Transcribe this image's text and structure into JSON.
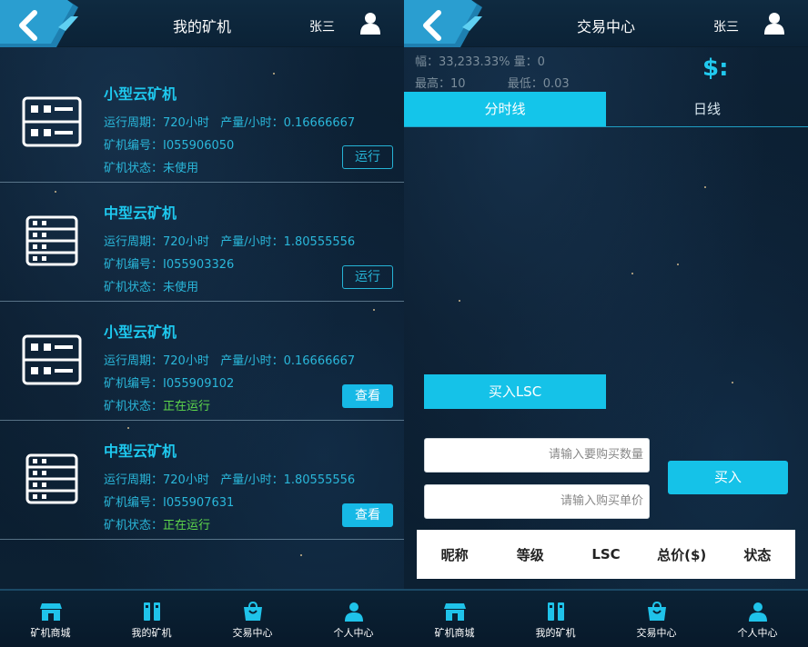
{
  "left_screen": {
    "header": {
      "title": "我的矿机",
      "user_name": "张三"
    },
    "machines": [
      {
        "name": "小型云矿机",
        "cycle": "运行周期：720小时",
        "output": "产量/小时：0.16666667",
        "id_label": "矿机编号：",
        "id": "I055906050",
        "status_label": "矿机状态：",
        "status": "未使用",
        "action": "运行"
      },
      {
        "name": "中型云矿机",
        "cycle": "运行周期：720小时",
        "output": "产量/小时：1.80555556",
        "id_label": "矿机编号：",
        "id": "I055903326",
        "status_label": "矿机状态：",
        "status": "未使用",
        "action": "运行"
      },
      {
        "name": "小型云矿机",
        "cycle": "运行周期：720小时",
        "output": "产量/小时：0.16666667",
        "id_label": "矿机编号：",
        "id": "I055909102",
        "status_label": "矿机状态：",
        "status": "正在运行",
        "action": "查看"
      },
      {
        "name": "中型云矿机",
        "cycle": "运行周期：720小时",
        "output": "产量/小时：1.80555556",
        "id_label": "矿机编号：",
        "id": "I055907631",
        "status_label": "矿机状态：",
        "status": "正在运行",
        "action": "查看"
      }
    ]
  },
  "right_screen": {
    "header": {
      "title": "交易中心",
      "user_name": "张三"
    },
    "ticker": {
      "change": "幅：33,233.33%",
      "volume": "量：0",
      "high": "最高：10",
      "low": "最低：0.03"
    },
    "dollar_symbol": "$:",
    "tabs": [
      {
        "label": "分时线",
        "active": true
      },
      {
        "label": "日线",
        "active": false
      }
    ],
    "buy_tab_label": "买入LSC",
    "quantity_placeholder": "请输入要购买数量",
    "price_placeholder": "请输入购买单价",
    "buy_button_label": "买入",
    "table_headers": [
      "昵称",
      "等级",
      "LSC",
      "总价($)",
      "状态"
    ]
  },
  "bottom_nav": [
    {
      "label": "矿机商城",
      "icon": "shop-icon"
    },
    {
      "label": "我的矿机",
      "icon": "machine-icon"
    },
    {
      "label": "交易中心",
      "icon": "bag-icon"
    },
    {
      "label": "个人中心",
      "icon": "user-icon"
    }
  ],
  "colors": {
    "accent": "#16b9e6",
    "text_cyan": "#2ab7da",
    "running_green": "#5fd94b"
  }
}
